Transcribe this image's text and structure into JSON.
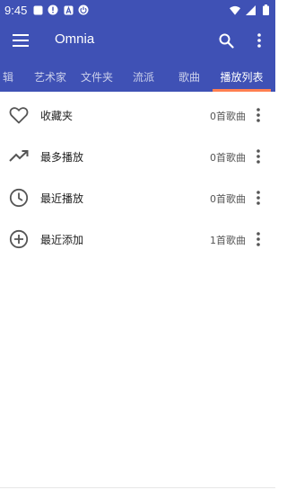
{
  "status_bar": {
    "time": "9:45",
    "left_icons": [
      "square-notification-icon",
      "alert-icon",
      "a-notification-icon",
      "power-notification-icon"
    ],
    "right_icons": [
      "wifi-icon",
      "signal-icon",
      "battery-icon"
    ]
  },
  "app_bar": {
    "title": "Omnia",
    "color": "#3f51b5"
  },
  "tabs": [
    {
      "label": "辑"
    },
    {
      "label": "艺术家"
    },
    {
      "label": "文件夹"
    },
    {
      "label": "流派"
    },
    {
      "label": "歌曲"
    },
    {
      "label": "播放列表",
      "active": true
    }
  ],
  "accent_color": "#ff7f50",
  "playlists": [
    {
      "icon": "heart-outline-icon",
      "label": "收藏夹",
      "count": "0首歌曲"
    },
    {
      "icon": "trending-up-icon",
      "label": "最多播放",
      "count": "0首歌曲"
    },
    {
      "icon": "clock-icon",
      "label": "最近播放",
      "count": "0首歌曲"
    },
    {
      "icon": "add-circle-icon",
      "label": "最近添加",
      "count": "1首歌曲"
    }
  ]
}
